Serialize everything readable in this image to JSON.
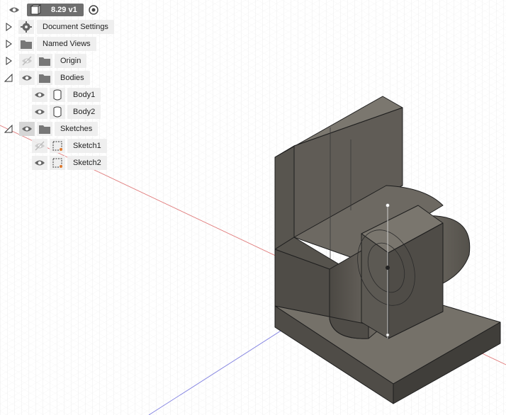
{
  "header": {
    "version_label": "8.29 v1"
  },
  "browser": {
    "items": [
      {
        "label": "Document Settings",
        "expander": "collapsed",
        "icon": "gear-icon"
      },
      {
        "label": "Named Views",
        "expander": "collapsed",
        "icon": "folder-icon"
      },
      {
        "label": "Origin",
        "expander": "collapsed",
        "icon": "folder-icon",
        "visibility": "hidden"
      },
      {
        "label": "Bodies",
        "expander": "expanded",
        "icon": "folder-icon",
        "visibility": "visible",
        "children": [
          {
            "label": "Body1",
            "icon": "body-icon",
            "visibility": "visible"
          },
          {
            "label": "Body2",
            "icon": "body-icon",
            "visibility": "visible"
          }
        ]
      },
      {
        "label": "Sketches",
        "expander": "expanded",
        "icon": "folder-icon",
        "visibility": "visible",
        "children": [
          {
            "label": "Sketch1",
            "icon": "sketch-icon",
            "visibility": "hidden"
          },
          {
            "label": "Sketch2",
            "icon": "sketch-icon",
            "visibility": "visible"
          }
        ]
      }
    ]
  },
  "colors": {
    "grid_minor": "#e6e6e6",
    "grid_major": "#cfcfcf",
    "x_axis": "#e07070",
    "y_axis": "#8080e0",
    "model_top": "#6e6a63",
    "model_left": "#5a5751",
    "model_right": "#4a4843",
    "edge": "#1e1e1e"
  }
}
